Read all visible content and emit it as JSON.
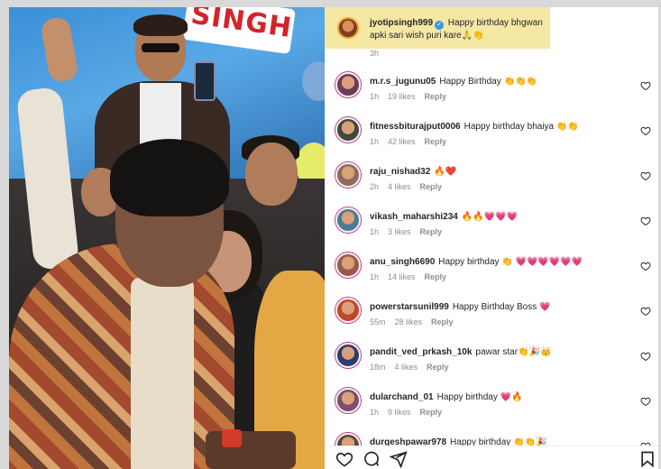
{
  "caption": {
    "username": "jyotipsingh999",
    "text": "Happy birthday bhgwan apki sari wish puri kare🙏👏",
    "time": "3h"
  },
  "comments": [
    {
      "username": "m.r.s_jugunu05",
      "text": "Happy Birthday 👏👏👏",
      "time": "1h",
      "likes": "19 likes",
      "reply": "Reply",
      "avatar_color": "#6b3b5a"
    },
    {
      "username": "fitnessbiturajput0006",
      "text": "Happy birthday bhaiya 👏👏",
      "time": "1h",
      "likes": "42 likes",
      "reply": "Reply",
      "avatar_color": "#3c4b3a"
    },
    {
      "username": "raju_nishad32",
      "text": "🔥❤️",
      "time": "2h",
      "likes": "4 likes",
      "reply": "Reply",
      "avatar_color": "#8a6d5c"
    },
    {
      "username": "vikash_maharshi234",
      "text": "🔥🔥💗💗💗",
      "time": "1h",
      "likes": "3 likes",
      "reply": "Reply",
      "avatar_color": "#4a7a9a"
    },
    {
      "username": "anu_singh6690",
      "text": "Happy birthday 👏 💗💗💗💗💗💗",
      "time": "1h",
      "likes": "14 likes",
      "reply": "Reply",
      "avatar_color": "#9a5a4a"
    },
    {
      "username": "powerstarsunil999",
      "text": "Happy Birthday Boss 💗",
      "time": "55m",
      "likes": "28 likes",
      "reply": "Reply",
      "avatar_color": "#c2452d"
    },
    {
      "username": "pandit_ved_prkash_10k",
      "text": "pawar star👏🎉👑",
      "time": "18m",
      "likes": "4 likes",
      "reply": "Reply",
      "avatar_color": "#2e3d6a"
    },
    {
      "username": "dularchand_01",
      "text": "Happy birthday 💗🔥",
      "time": "1h",
      "likes": "9 likes",
      "reply": "Reply",
      "avatar_color": "#7b4f6f"
    },
    {
      "username": "durgeshpawar978",
      "text": "Happy birthday 👏👏🎉",
      "time": "",
      "likes": "",
      "reply": "",
      "avatar_color": "#5a4a3a"
    }
  ],
  "banner_text": "SINGH",
  "actions": {
    "like": "heart-icon",
    "comment": "comment-icon",
    "share": "share-icon",
    "save": "bookmark-icon"
  },
  "colors": {
    "caption_highlight": "#f5e7a4",
    "verified": "#3897f0",
    "meta_gray": "#8e8e8e"
  }
}
